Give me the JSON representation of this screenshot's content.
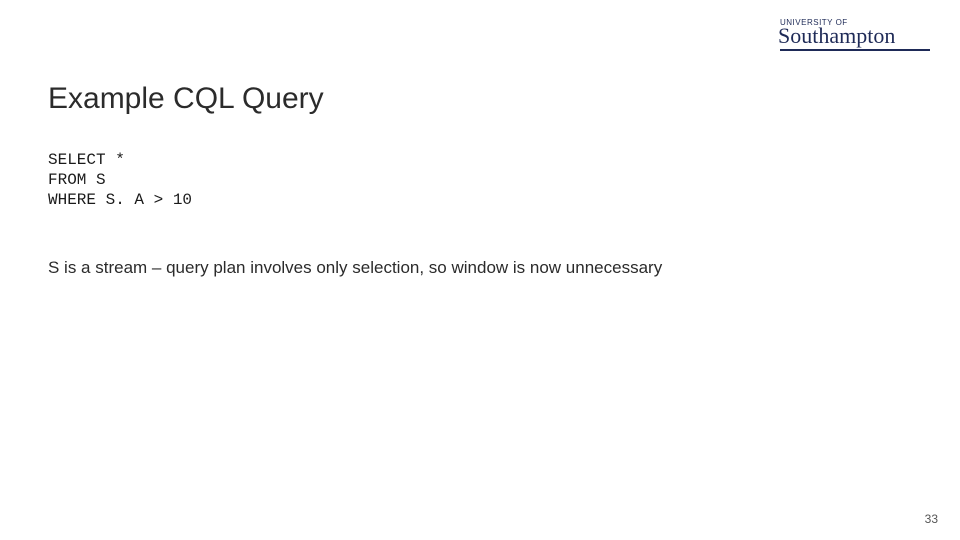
{
  "logo": {
    "overline": "UNIVERSITY OF",
    "name": "Southampton"
  },
  "title": "Example CQL Query",
  "code": "SELECT *\nFROM S\nWHERE S. A > 10",
  "body": "S is a stream – query plan involves only selection, so window is now unnecessary",
  "page_number": "33"
}
